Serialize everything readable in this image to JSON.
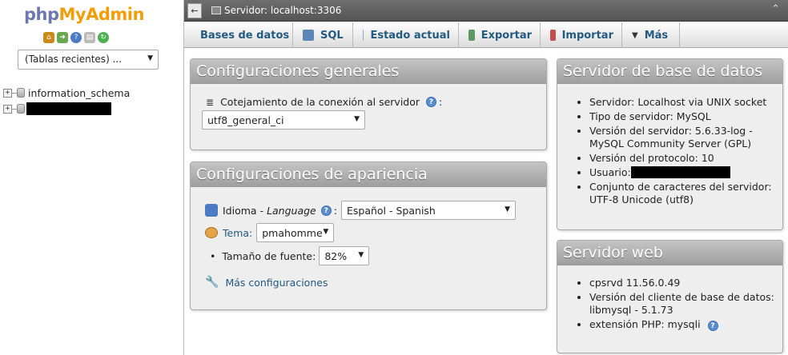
{
  "logo": {
    "php": "php",
    "my": "My",
    "admin": "Admin"
  },
  "nav_icons": [
    "home-icon",
    "logout-icon",
    "help-icon",
    "docs-icon",
    "reload-icon"
  ],
  "recent_tables": {
    "selected": "(Tablas recientes) ...",
    "arrow": "▼"
  },
  "tree": {
    "databases": [
      {
        "label": "information_schema"
      },
      {
        "label": ""
      }
    ]
  },
  "topbar": {
    "back": "←",
    "server": "Servidor: localhost:3306",
    "collapse": "⌃"
  },
  "tabs": [
    {
      "label": "Bases de datos",
      "icon": "database-icon",
      "color": "#9aa7b8"
    },
    {
      "label": "SQL",
      "icon": "sql-icon",
      "color": "#5b86b8"
    },
    {
      "label": "Estado actual",
      "icon": "status-icon",
      "color": "#9aa7b8"
    },
    {
      "label": "Exportar",
      "icon": "export-icon",
      "color": "#5a9a62"
    },
    {
      "label": "Importar",
      "icon": "import-icon",
      "color": "#c05050"
    },
    {
      "label": "Más",
      "icon": "chevron-down-icon",
      "color": "#444444"
    }
  ],
  "general": {
    "title": "Configuraciones generales",
    "collation_label": "Cotejamiento de la conexión al servidor",
    "collation_value": "utf8_general_ci"
  },
  "appearance": {
    "title": "Configuraciones de apariencia",
    "language_label": "Idioma -",
    "language_italic": "Language",
    "language_value": "Español - Spanish",
    "theme_label": "Tema:",
    "theme_value": "pmahomme",
    "font_label": "Tamaño de fuente:",
    "font_value": "82%",
    "more_label": "Más configuraciones"
  },
  "db_server": {
    "title": "Servidor de base de datos",
    "items": [
      "Servidor: Localhost via UNIX socket",
      "Tipo de servidor: MySQL",
      "Versión del servidor: 5.6.33-log - MySQL Community Server (GPL)",
      "Versión del protocolo: 10",
      "Usuario:",
      "Conjunto de caracteres del servidor: UTF-8 Unicode (utf8)"
    ]
  },
  "web_server": {
    "title": "Servidor web",
    "items": [
      "cpsrvd 11.56.0.49",
      "Versión del cliente de base de datos: libmysql - 5.1.73",
      "extensión PHP: mysqli"
    ]
  }
}
